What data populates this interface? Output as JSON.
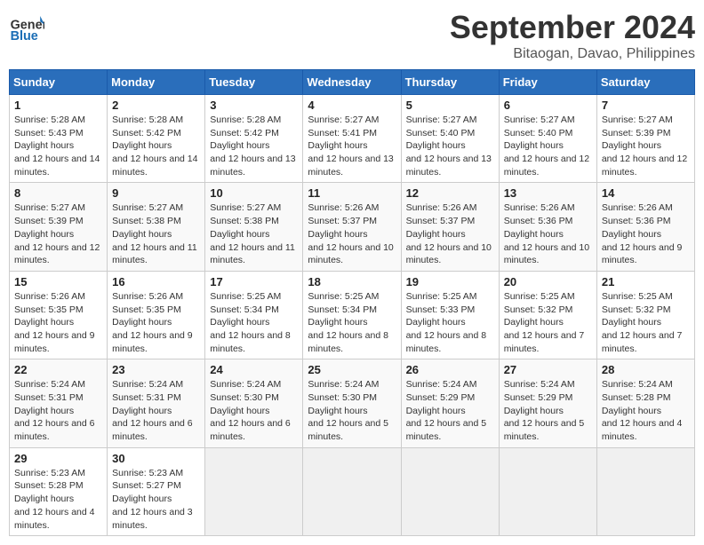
{
  "header": {
    "logo_general": "General",
    "logo_blue": "Blue",
    "month": "September 2024",
    "location": "Bitaogan, Davao, Philippines"
  },
  "weekdays": [
    "Sunday",
    "Monday",
    "Tuesday",
    "Wednesday",
    "Thursday",
    "Friday",
    "Saturday"
  ],
  "weeks": [
    [
      {
        "day": "1",
        "sunrise": "5:28 AM",
        "sunset": "5:43 PM",
        "daylight": "12 hours and 14 minutes."
      },
      {
        "day": "2",
        "sunrise": "5:28 AM",
        "sunset": "5:42 PM",
        "daylight": "12 hours and 14 minutes."
      },
      {
        "day": "3",
        "sunrise": "5:28 AM",
        "sunset": "5:42 PM",
        "daylight": "12 hours and 13 minutes."
      },
      {
        "day": "4",
        "sunrise": "5:27 AM",
        "sunset": "5:41 PM",
        "daylight": "12 hours and 13 minutes."
      },
      {
        "day": "5",
        "sunrise": "5:27 AM",
        "sunset": "5:40 PM",
        "daylight": "12 hours and 13 minutes."
      },
      {
        "day": "6",
        "sunrise": "5:27 AM",
        "sunset": "5:40 PM",
        "daylight": "12 hours and 12 minutes."
      },
      {
        "day": "7",
        "sunrise": "5:27 AM",
        "sunset": "5:39 PM",
        "daylight": "12 hours and 12 minutes."
      }
    ],
    [
      {
        "day": "8",
        "sunrise": "5:27 AM",
        "sunset": "5:39 PM",
        "daylight": "12 hours and 12 minutes."
      },
      {
        "day": "9",
        "sunrise": "5:27 AM",
        "sunset": "5:38 PM",
        "daylight": "12 hours and 11 minutes."
      },
      {
        "day": "10",
        "sunrise": "5:27 AM",
        "sunset": "5:38 PM",
        "daylight": "12 hours and 11 minutes."
      },
      {
        "day": "11",
        "sunrise": "5:26 AM",
        "sunset": "5:37 PM",
        "daylight": "12 hours and 10 minutes."
      },
      {
        "day": "12",
        "sunrise": "5:26 AM",
        "sunset": "5:37 PM",
        "daylight": "12 hours and 10 minutes."
      },
      {
        "day": "13",
        "sunrise": "5:26 AM",
        "sunset": "5:36 PM",
        "daylight": "12 hours and 10 minutes."
      },
      {
        "day": "14",
        "sunrise": "5:26 AM",
        "sunset": "5:36 PM",
        "daylight": "12 hours and 9 minutes."
      }
    ],
    [
      {
        "day": "15",
        "sunrise": "5:26 AM",
        "sunset": "5:35 PM",
        "daylight": "12 hours and 9 minutes."
      },
      {
        "day": "16",
        "sunrise": "5:26 AM",
        "sunset": "5:35 PM",
        "daylight": "12 hours and 9 minutes."
      },
      {
        "day": "17",
        "sunrise": "5:25 AM",
        "sunset": "5:34 PM",
        "daylight": "12 hours and 8 minutes."
      },
      {
        "day": "18",
        "sunrise": "5:25 AM",
        "sunset": "5:34 PM",
        "daylight": "12 hours and 8 minutes."
      },
      {
        "day": "19",
        "sunrise": "5:25 AM",
        "sunset": "5:33 PM",
        "daylight": "12 hours and 8 minutes."
      },
      {
        "day": "20",
        "sunrise": "5:25 AM",
        "sunset": "5:32 PM",
        "daylight": "12 hours and 7 minutes."
      },
      {
        "day": "21",
        "sunrise": "5:25 AM",
        "sunset": "5:32 PM",
        "daylight": "12 hours and 7 minutes."
      }
    ],
    [
      {
        "day": "22",
        "sunrise": "5:24 AM",
        "sunset": "5:31 PM",
        "daylight": "12 hours and 6 minutes."
      },
      {
        "day": "23",
        "sunrise": "5:24 AM",
        "sunset": "5:31 PM",
        "daylight": "12 hours and 6 minutes."
      },
      {
        "day": "24",
        "sunrise": "5:24 AM",
        "sunset": "5:30 PM",
        "daylight": "12 hours and 6 minutes."
      },
      {
        "day": "25",
        "sunrise": "5:24 AM",
        "sunset": "5:30 PM",
        "daylight": "12 hours and 5 minutes."
      },
      {
        "day": "26",
        "sunrise": "5:24 AM",
        "sunset": "5:29 PM",
        "daylight": "12 hours and 5 minutes."
      },
      {
        "day": "27",
        "sunrise": "5:24 AM",
        "sunset": "5:29 PM",
        "daylight": "12 hours and 5 minutes."
      },
      {
        "day": "28",
        "sunrise": "5:24 AM",
        "sunset": "5:28 PM",
        "daylight": "12 hours and 4 minutes."
      }
    ],
    [
      {
        "day": "29",
        "sunrise": "5:23 AM",
        "sunset": "5:28 PM",
        "daylight": "12 hours and 4 minutes."
      },
      {
        "day": "30",
        "sunrise": "5:23 AM",
        "sunset": "5:27 PM",
        "daylight": "12 hours and 3 minutes."
      },
      null,
      null,
      null,
      null,
      null
    ]
  ]
}
